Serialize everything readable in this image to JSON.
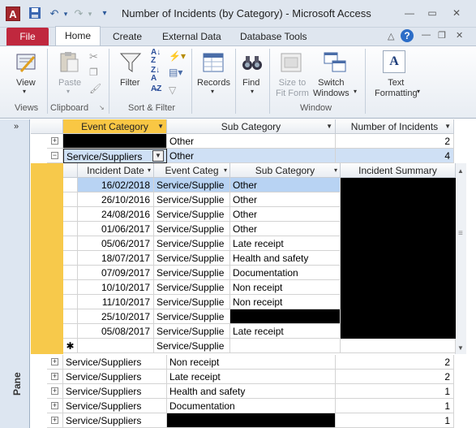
{
  "window": {
    "title": "Number of Incidents (by Category)  -  Microsoft Access",
    "app_letter": "A"
  },
  "tabs": [
    "File",
    "Home",
    "Create",
    "External Data",
    "Database Tools"
  ],
  "ribbon": {
    "view_label": "View",
    "paste_label": "Paste",
    "filter_label": "Filter",
    "records_label": "Records",
    "find_label": "Find",
    "size_to_fit_label": "Size to\nFit Form",
    "switch_windows_label": "Switch\nWindows",
    "text_formatting_label": "Text\nFormatting",
    "groups": [
      "Views",
      "Clipboard",
      "Sort & Filter",
      "Window"
    ]
  },
  "nav_pane": {
    "label": "Pane"
  },
  "main": {
    "columns": [
      "Event Category",
      "Sub Category",
      "Number of Incidents"
    ],
    "row_first": {
      "event": "",
      "sub": "Other",
      "count": "2"
    },
    "row_expanded": {
      "event": "Service/Suppliers",
      "sub": "Other",
      "count": "4"
    },
    "rows_after": [
      {
        "event": "Service/Suppliers",
        "sub": "Non receipt",
        "count": "2"
      },
      {
        "event": "Service/Suppliers",
        "sub": "Late receipt",
        "count": "2"
      },
      {
        "event": "Service/Suppliers",
        "sub": "Health and safety",
        "count": "1"
      },
      {
        "event": "Service/Suppliers",
        "sub": "Documentation",
        "count": "1"
      },
      {
        "event": "Service/Suppliers",
        "sub": "",
        "count": "1"
      }
    ]
  },
  "sub": {
    "columns": [
      "Incident Date",
      "Event Categ",
      "Sub Category",
      "Incident Summary"
    ],
    "rows": [
      {
        "date": "16/02/2018",
        "event": "Service/Supplie",
        "sub": "Other"
      },
      {
        "date": "26/10/2016",
        "event": "Service/Supplie",
        "sub": "Other"
      },
      {
        "date": "24/08/2016",
        "event": "Service/Supplie",
        "sub": "Other"
      },
      {
        "date": "01/06/2017",
        "event": "Service/Supplie",
        "sub": "Other"
      },
      {
        "date": "05/06/2017",
        "event": "Service/Supplie",
        "sub": "Late receipt"
      },
      {
        "date": "18/07/2017",
        "event": "Service/Supplie",
        "sub": "Health and safety"
      },
      {
        "date": "07/09/2017",
        "event": "Service/Supplie",
        "sub": "Documentation"
      },
      {
        "date": "10/10/2017",
        "event": "Service/Supplie",
        "sub": "Non receipt"
      },
      {
        "date": "11/10/2017",
        "event": "Service/Supplie",
        "sub": "Non receipt"
      },
      {
        "date": "25/10/2017",
        "event": "Service/Supplie",
        "sub": ""
      },
      {
        "date": "05/08/2017",
        "event": "Service/Supplie",
        "sub": "Late receipt"
      }
    ],
    "new_row": {
      "marker": "✱",
      "event": "Service/Supplie"
    }
  }
}
